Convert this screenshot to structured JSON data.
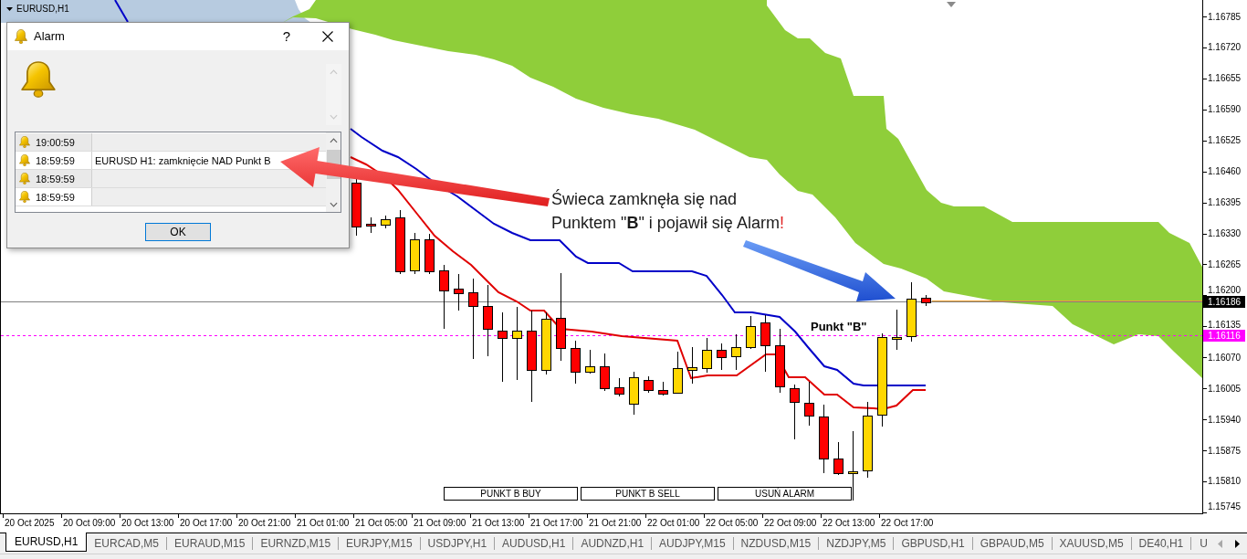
{
  "chart": {
    "title": "EURUSD,H1",
    "annotation": {
      "lines": [
        "Świeca zamknęła się nad",
        "Punktem \"**B**\" i pojawił się Alarm"
      ],
      "accent": "!"
    },
    "level_label": "Punkt \"B\"",
    "buttons": [
      "PUNKT B BUY",
      "PUNKT B SELL",
      "USUŃ ALARM"
    ]
  },
  "alarm_dialog": {
    "title": "Alarm",
    "help": "?",
    "rows": [
      {
        "time": "19:00:59"
      },
      {
        "time": "18:59:59",
        "message": "EURUSD H1: zamknięcie NAD Punkt B"
      },
      {
        "time": "18:59:59"
      },
      {
        "time": "18:59:59"
      }
    ],
    "ok_button": "OK"
  },
  "price_axis": {
    "labels": [
      "1.16785",
      "1.16720",
      "1.16655",
      "1.16590",
      "1.16525",
      "1.16460",
      "1.16395",
      "1.16330",
      "1.16265",
      "1.16200",
      "1.16135",
      "1.16070",
      "1.16005",
      "1.15940",
      "1.15875",
      "1.15810",
      "1.15745"
    ],
    "tags": [
      {
        "text": "1.16186",
        "color": "#000000"
      },
      {
        "text": "1.16116",
        "color": "#ff00ff"
      }
    ]
  },
  "time_axis": {
    "labels": [
      "20 Oct 2025",
      "20 Oct 09:00",
      "20 Oct 13:00",
      "20 Oct 17:00",
      "20 Oct 21:00",
      "21 Oct 01:00",
      "21 Oct 05:00",
      "21 Oct 09:00",
      "21 Oct 13:00",
      "21 Oct 17:00",
      "21 Oct 21:00",
      "22 Oct 01:00",
      "22 Oct 05:00",
      "22 Oct 09:00",
      "22 Oct 13:00",
      "22 Oct 17:00"
    ]
  },
  "tabs": [
    {
      "label": "EURUSD,H1",
      "selected": true
    },
    {
      "label": "EURCAD,M5",
      "selected": false
    },
    {
      "label": "EURAUD,M15",
      "selected": false
    },
    {
      "label": "EURNZD,M15",
      "selected": false
    },
    {
      "label": "EURJPY,M15",
      "selected": false
    },
    {
      "label": "USDJPY,H1",
      "selected": false
    },
    {
      "label": "AUDUSD,H1",
      "selected": false
    },
    {
      "label": "AUDNZD,H1",
      "selected": false
    },
    {
      "label": "AUDJPY,M15",
      "selected": false
    },
    {
      "label": "NZDUSD,M15",
      "selected": false
    },
    {
      "label": "NZDJPY,M5",
      "selected": false
    },
    {
      "label": "GBPUSD,H1",
      "selected": false
    },
    {
      "label": "GBPAUD,M5",
      "selected": false
    },
    {
      "label": "XAUUSD,M5",
      "selected": false
    },
    {
      "label": "DE40,H1",
      "selected": false
    },
    {
      "label": "U",
      "selected": false
    }
  ],
  "tab_scroll": [
    {
      "kind": "back",
      "disabled": true
    },
    {
      "kind": "forward",
      "disabled": false
    }
  ]
}
